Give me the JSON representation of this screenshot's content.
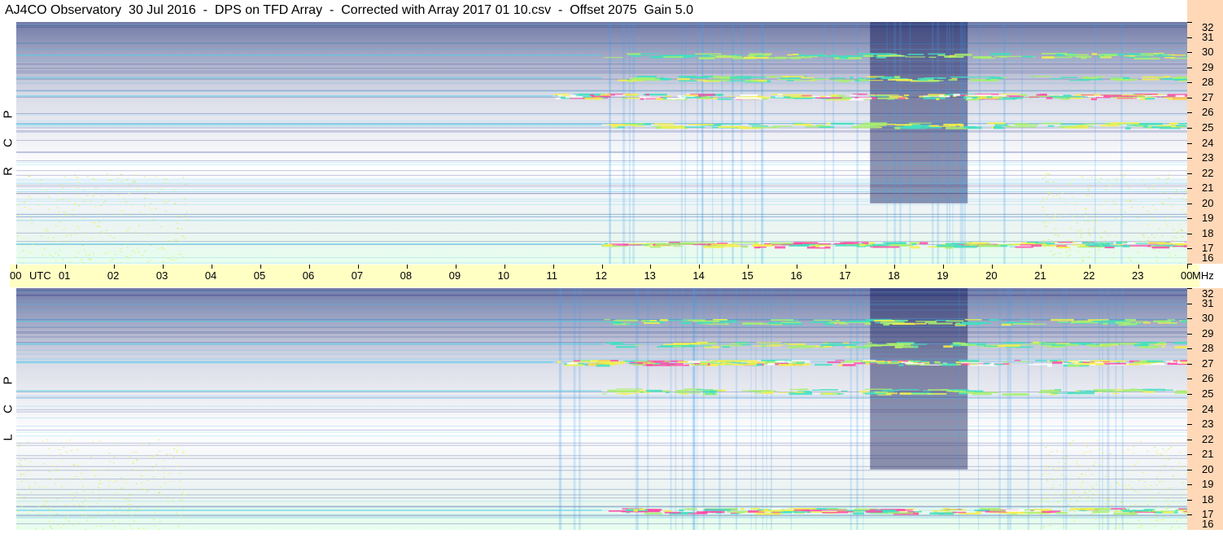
{
  "title": "AJ4CO Observatory  30 Jul 2016  -  DPS on TFD Array  -  Corrected with Array 2017 01 10.csv  -  Offset 2075  Gain 5.0",
  "panels": [
    {
      "id": "rcp",
      "label": [
        "R",
        "C",
        "P"
      ]
    },
    {
      "id": "lcp",
      "label": [
        "L",
        "C",
        "P"
      ]
    }
  ],
  "chart_data": {
    "type": "heatmap",
    "title": "AJ4CO Observatory  30 Jul 2016  -  DPS on TFD Array  -  Corrected with Array 2017 01 10.csv  -  Offset 2075  Gain 5.0",
    "x": {
      "unit_label": "UTC",
      "ticks": [
        "00",
        "01",
        "02",
        "03",
        "04",
        "05",
        "06",
        "07",
        "08",
        "09",
        "10",
        "11",
        "12",
        "13",
        "14",
        "15",
        "16",
        "17",
        "18",
        "19",
        "20",
        "21",
        "22",
        "23",
        "00"
      ],
      "range": [
        0,
        24
      ]
    },
    "y": {
      "unit_label": "MHz",
      "ticks": [
        "32",
        "31",
        "30",
        "29",
        "28",
        "27",
        "26",
        "25",
        "24",
        "23",
        "22",
        "21",
        "20",
        "19",
        "18",
        "17",
        "16"
      ],
      "range": [
        16,
        32
      ]
    },
    "series": [
      {
        "name": "RCP"
      },
      {
        "name": "LCP"
      }
    ],
    "colormap": [
      "#0a1a6e",
      "#1e3fc8",
      "#2a6fe8",
      "#2fb6e8",
      "#3fe0c0",
      "#a8f070",
      "#f5f04a",
      "#ff4aa8",
      "#ffffff"
    ],
    "features": {
      "dayglow_center_utc": 3.5,
      "strong_bands_mhz": [
        27.1,
        17.3,
        25.2,
        29.8,
        28.3
      ],
      "dark_trough_utc": [
        17.5,
        19.5
      ]
    }
  }
}
